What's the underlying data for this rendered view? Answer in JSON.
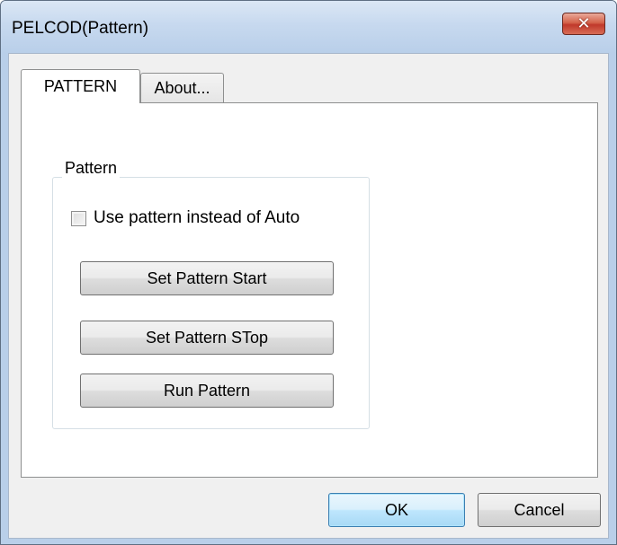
{
  "window": {
    "title": "PELCOD(Pattern)",
    "close_glyph": "✕",
    "accent_color": "#c0392b"
  },
  "tabs": [
    {
      "label": "PATTERN",
      "selected": true
    },
    {
      "label": "About...",
      "selected": false
    }
  ],
  "pattern_group": {
    "label": "Pattern",
    "use_pattern_checkbox": {
      "label": "Use pattern instead of Auto",
      "checked": false
    },
    "buttons": {
      "set_start": "Set Pattern Start",
      "set_stop": "Set Pattern STop",
      "run": "Run Pattern"
    }
  },
  "footer": {
    "ok": "OK",
    "cancel": "Cancel"
  },
  "icons": {
    "close": "close-icon",
    "checkbox": "checkbox-icon"
  }
}
